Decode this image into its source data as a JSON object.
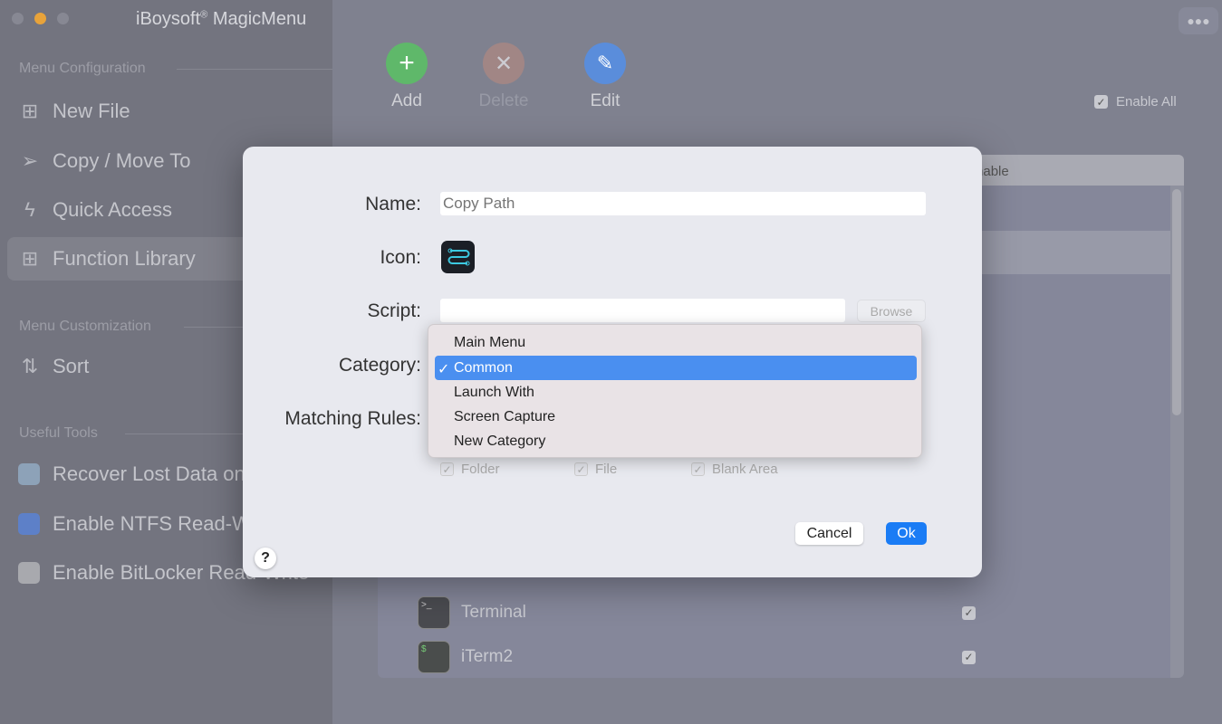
{
  "app": {
    "title": "iBoysoft",
    "title_sup": "®",
    "title_rest": " MagicMenu"
  },
  "sidebar": {
    "sections": [
      {
        "label": "Menu Configuration"
      },
      {
        "label": "Menu Customization"
      },
      {
        "label": "Useful Tools"
      }
    ],
    "items": [
      {
        "label": "New File",
        "icon": "new-file-icon"
      },
      {
        "label": "Copy / Move To",
        "icon": "send-icon"
      },
      {
        "label": "Quick Access",
        "icon": "lightning-icon"
      },
      {
        "label": "Function Library",
        "icon": "grid-icon",
        "selected": true
      },
      {
        "label": "Sort",
        "icon": "sort-icon"
      },
      {
        "label": "Recover Lost Data on",
        "icon": "data-recovery-app-icon"
      },
      {
        "label": "Enable NTFS Read-W",
        "icon": "ntfs-app-icon"
      },
      {
        "label": "Enable BitLocker Read-Write",
        "icon": "bitlocker-app-icon"
      }
    ]
  },
  "toolbar": {
    "add": "Add",
    "delete": "Delete",
    "edit": "Edit",
    "enable_all": "Enable All",
    "enable_all_checked": true
  },
  "table": {
    "header_enable": "Enable",
    "rows": [
      {
        "name": "Terminal",
        "enabled": true
      },
      {
        "name": "iTerm2",
        "enabled": true
      }
    ]
  },
  "dialog": {
    "name_label": "Name:",
    "name_placeholder": "Copy Path",
    "icon_label": "Icon:",
    "script_label": "Script:",
    "script_value": "",
    "browse": "Browse",
    "category_label": "Category:",
    "category_options": [
      "Main Menu",
      "Common",
      "Launch With",
      "Screen Capture",
      "New Category"
    ],
    "category_selected": "Common",
    "matching_label": "Matching Rules:",
    "rules": [
      {
        "label": "Folder",
        "checked": true
      },
      {
        "label": "File",
        "checked": true
      },
      {
        "label": "Blank Area",
        "checked": true
      }
    ],
    "cancel": "Cancel",
    "ok": "Ok",
    "help": "?"
  },
  "colors": {
    "accent": "#1a7cf5",
    "highlight": "#4a8ff0",
    "add": "#5fb86a",
    "delete": "#b98a80",
    "edit": "#5a8ddb"
  }
}
